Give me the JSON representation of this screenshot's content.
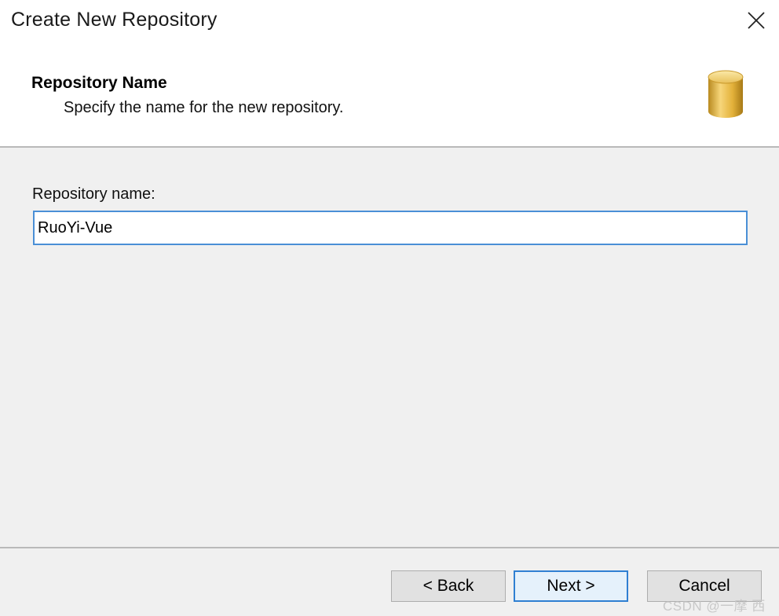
{
  "window": {
    "title": "Create New Repository",
    "close_icon": "close-icon"
  },
  "header": {
    "title": "Repository Name",
    "subtitle": "Specify the name for the new repository.",
    "icon": "database-icon",
    "icon_color": "#e3b13a"
  },
  "form": {
    "name_label": "Repository name:",
    "name_value": "RuoYi-Vue"
  },
  "footer": {
    "back_label": "< Back",
    "next_label": "Next >",
    "cancel_label": "Cancel"
  },
  "watermark": {
    "text": "CSDN @一摩 西"
  },
  "colors": {
    "focus_accent": "#4a8fd6",
    "content_bg": "#f0f0f0"
  }
}
